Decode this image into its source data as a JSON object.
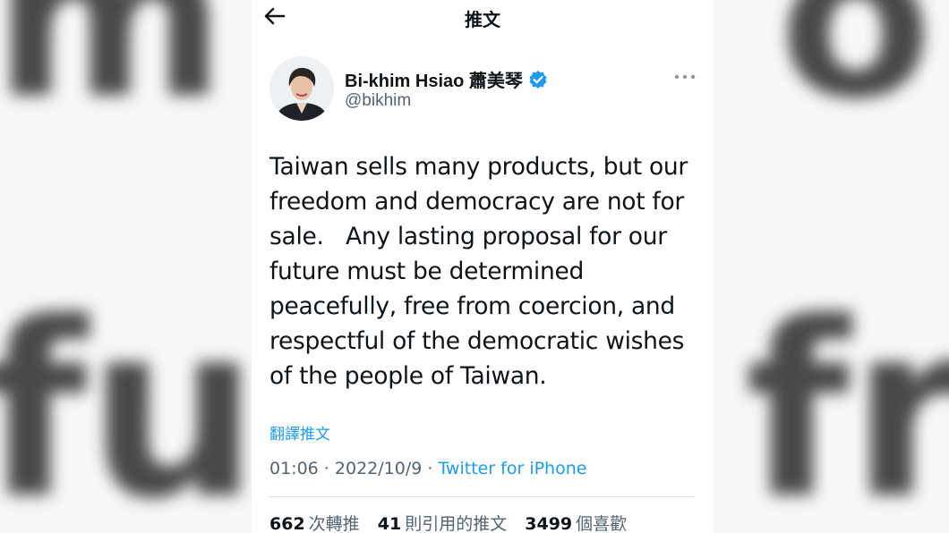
{
  "background": {
    "left_top": "m",
    "left_bottom": "fu",
    "right_top": "o",
    "right_bottom": "fre"
  },
  "header": {
    "title": "推文"
  },
  "author": {
    "name": "Bi-khim Hsiao 蕭美琴",
    "handle": "@bikhim",
    "verified": true
  },
  "tweet": {
    "text": "Taiwan sells many products, but our\nfreedom and democracy are not for\nsale.   Any lasting proposal for our\nfuture must be determined\npeacefully, free from coercion, and\nrespectful of the democratic wishes\nof the people of Taiwan.",
    "translate_label": "翻譯推文",
    "time": "01:06",
    "date": "2022/10/9",
    "separator": " · ",
    "source": "Twitter for iPhone"
  },
  "stats": {
    "retweets": {
      "count": "662",
      "label": "次轉推"
    },
    "quotes": {
      "count": "41",
      "label": "則引用的推文"
    },
    "likes": {
      "count": "3499",
      "label": "個喜歡"
    }
  },
  "colors": {
    "accent": "#1d9bf0",
    "text": "#0f1419",
    "secondary": "#536471"
  }
}
